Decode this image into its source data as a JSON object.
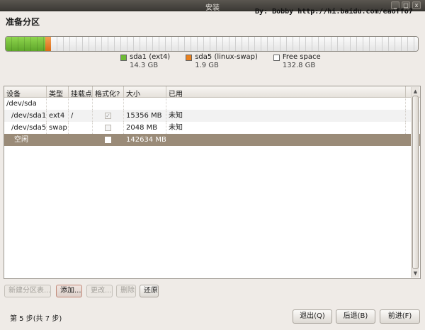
{
  "window": {
    "title": "安装",
    "controls": [
      "_",
      "□",
      "x"
    ]
  },
  "watermark": "By: Bobby http://hi.baidu.com/eaoffo7",
  "heading": "准备分区",
  "partitions_bar": [
    {
      "name": "sda1 (ext4)",
      "size": "14.3 GB",
      "color": "#6dbb35",
      "fraction": 0.097
    },
    {
      "name": "sda5 (linux-swap)",
      "size": "1.9 GB",
      "color": "#e9811f",
      "fraction": 0.013
    },
    {
      "name": "Free space",
      "size": "132.8 GB",
      "color": "#ffffff",
      "fraction": 0.89
    }
  ],
  "table": {
    "headers": [
      "设备",
      "类型",
      "挂载点",
      "格式化?",
      "大小",
      "已用"
    ],
    "rows": [
      {
        "device": "/dev/sda",
        "type": "",
        "mount": "",
        "format": null,
        "size": "",
        "used": ""
      },
      {
        "device": "/dev/sda1",
        "type": "ext4",
        "mount": "/",
        "format": "checked",
        "size": "15356 MB",
        "used": "未知"
      },
      {
        "device": "/dev/sda5",
        "type": "swap",
        "mount": "",
        "format": "unchecked",
        "size": "2048 MB",
        "used": "未知"
      },
      {
        "device": "空闲",
        "type": "",
        "mount": "",
        "format": "unchecked",
        "size": "142634 MB",
        "used": "",
        "selected": true
      }
    ]
  },
  "actions": {
    "new_table": "新建分区表...",
    "add": "添加...",
    "change": "更改...",
    "delete": "删除",
    "revert": "还原"
  },
  "footer": {
    "step": "第 5 步(共 7 步)",
    "quit": "退出(Q)",
    "back": "后退(B)",
    "forward": "前进(F)"
  }
}
